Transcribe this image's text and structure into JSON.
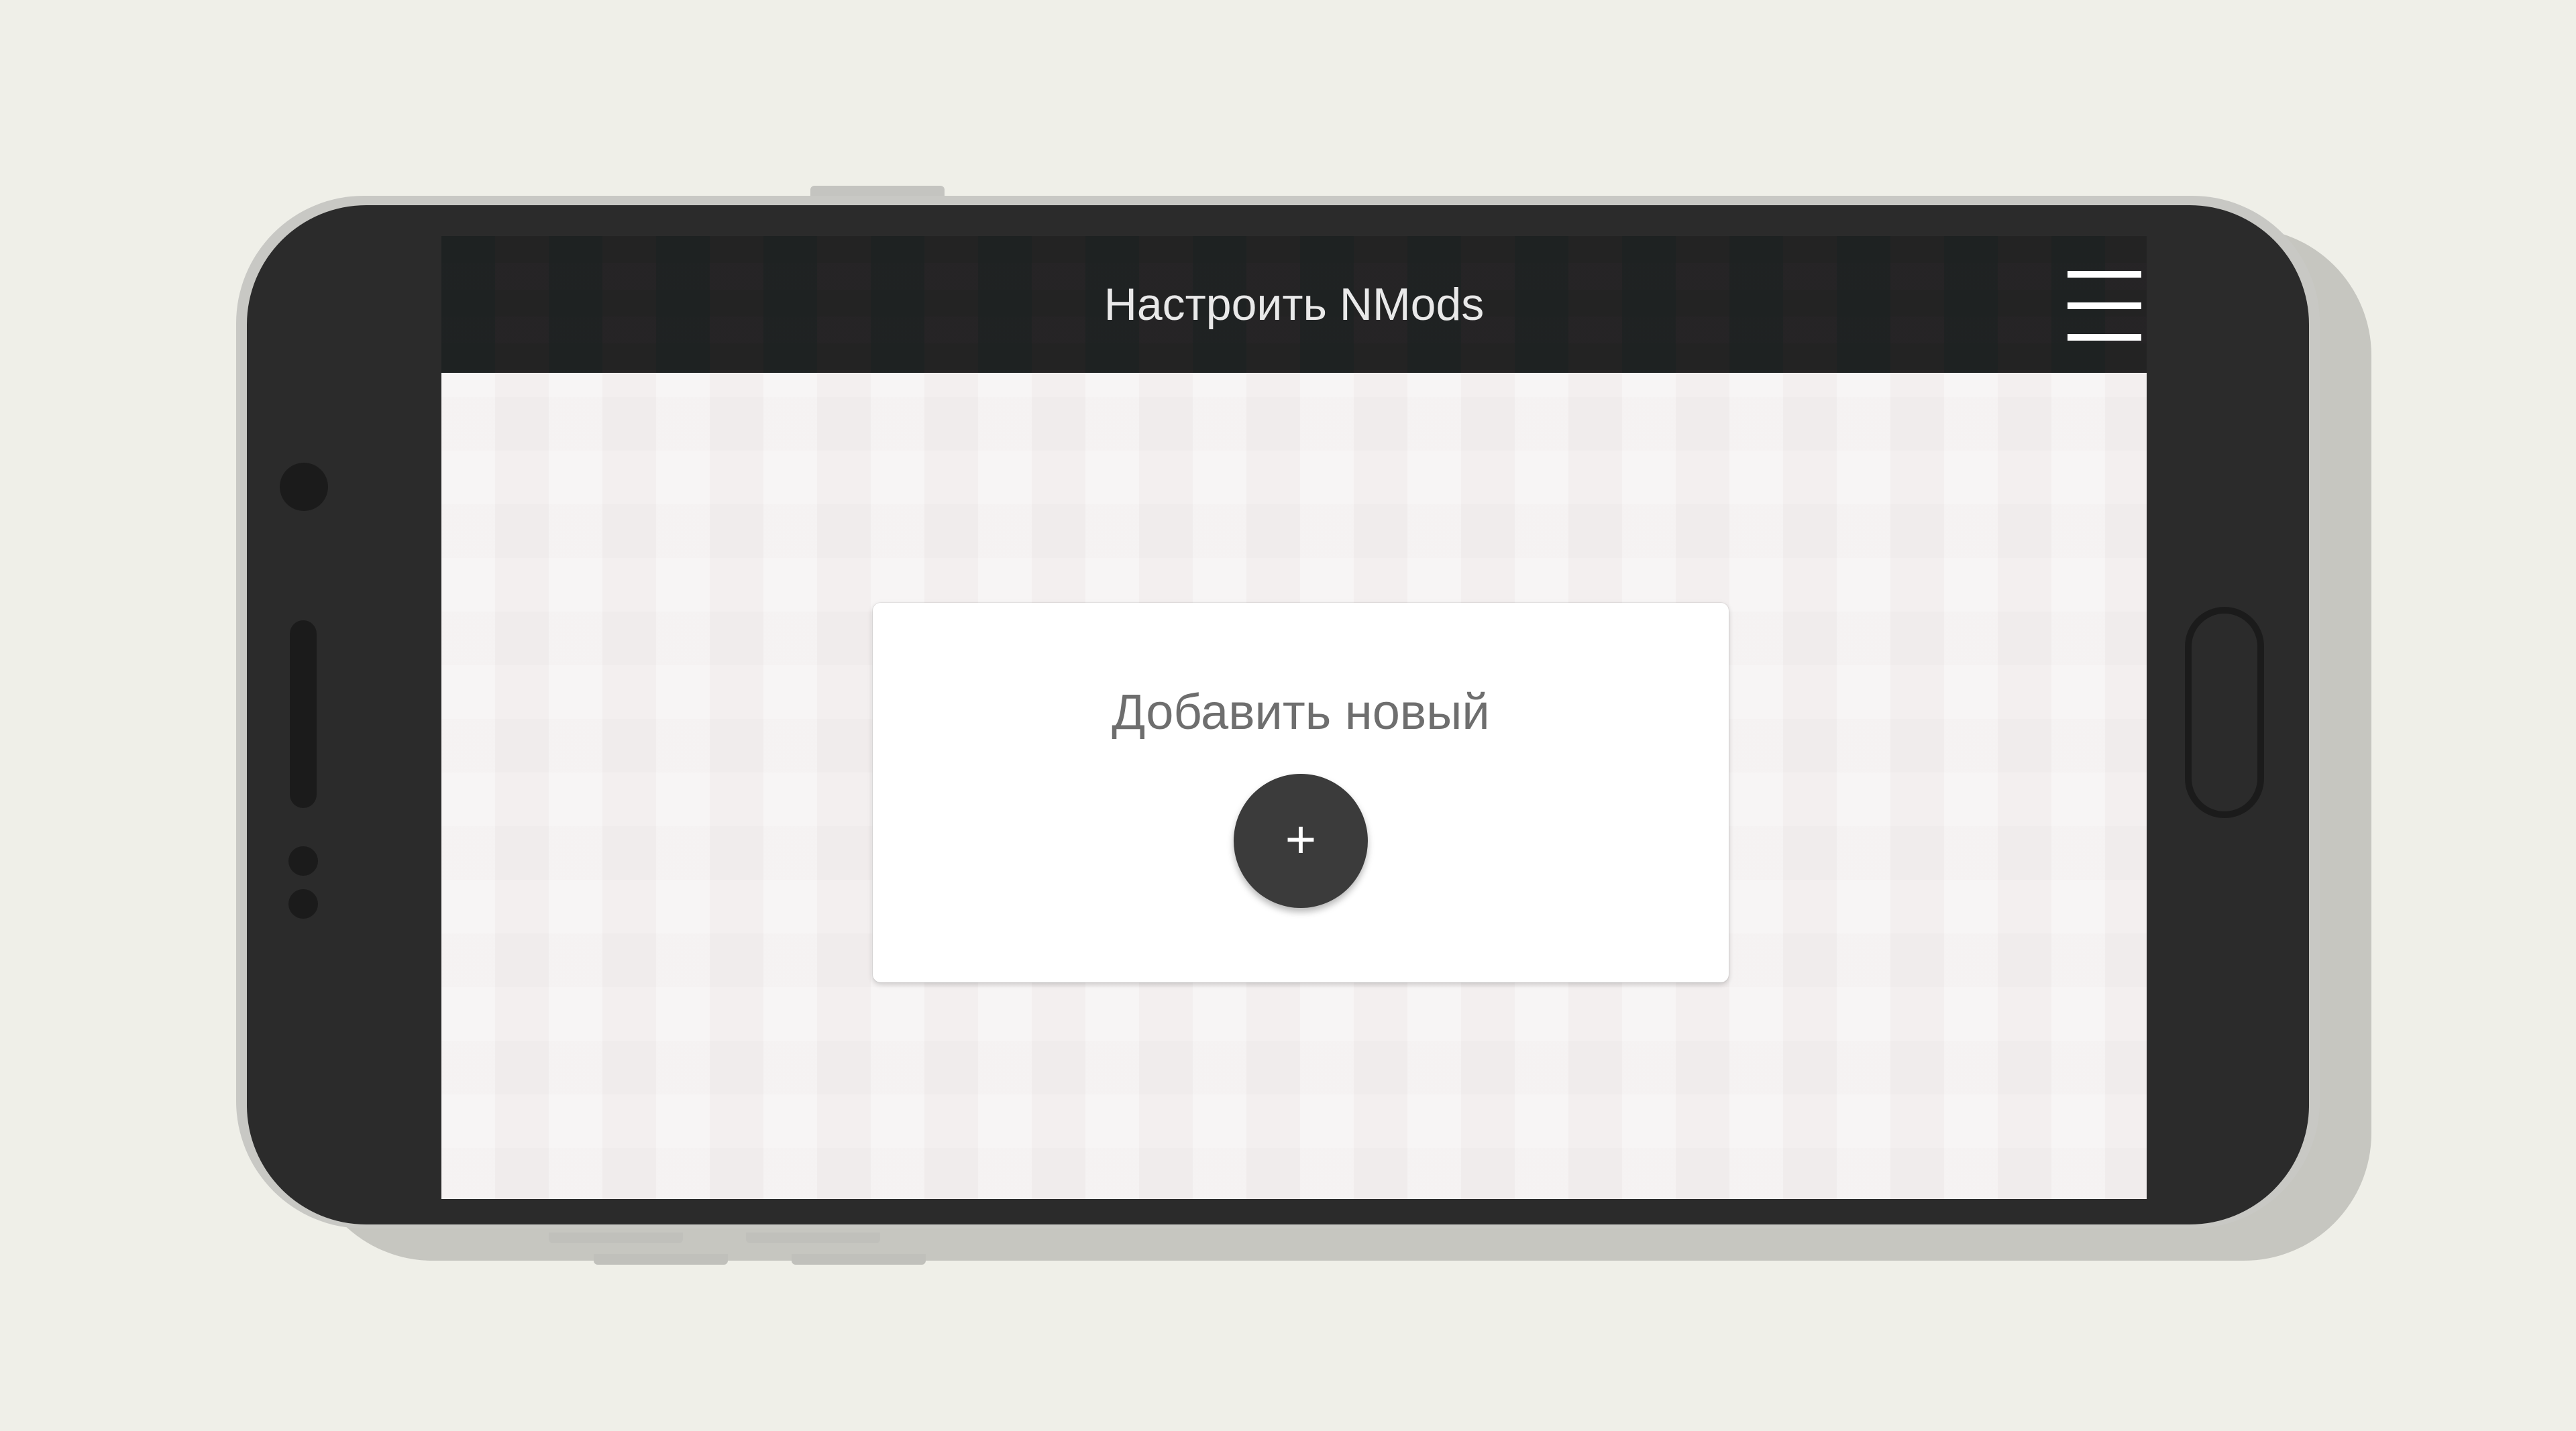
{
  "app": {
    "title": "Настроить NMods"
  },
  "header": {
    "menu_icon": "hamburger-menu-icon"
  },
  "card": {
    "label": "Добавить новый",
    "add_button_glyph": "+",
    "add_icon": "plus-icon"
  },
  "colors": {
    "background": "#efefe8",
    "device_frame": "#2b2b2b",
    "topbar": "#232323",
    "screen": "#f3efef",
    "card": "#ffffff",
    "fab": "#3b3b3b"
  }
}
